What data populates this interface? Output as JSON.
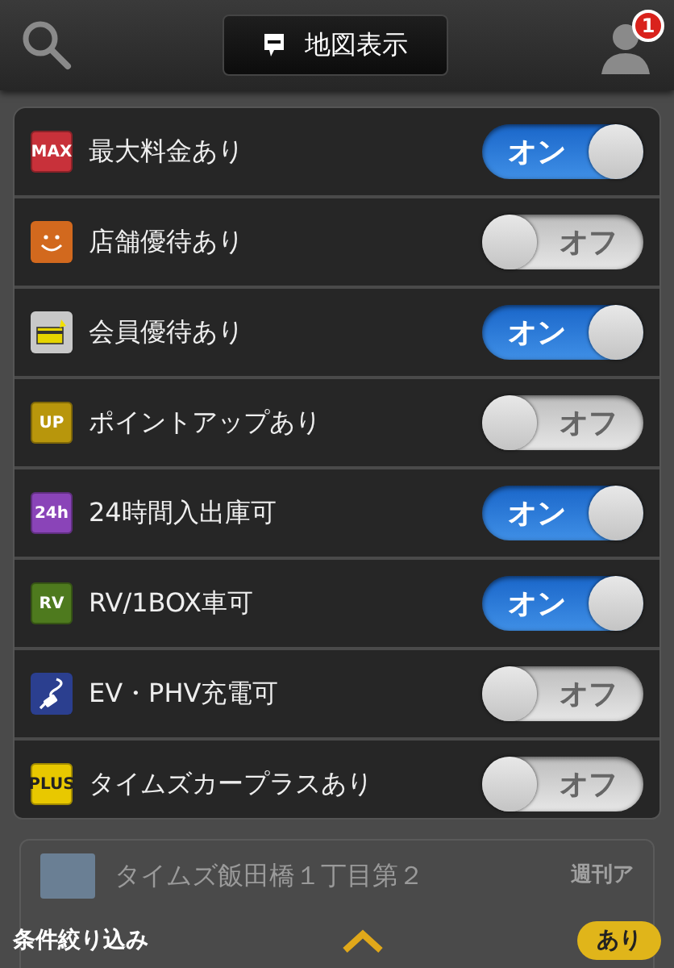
{
  "header": {
    "map_button": "地図表示",
    "notification_count": "1"
  },
  "filters": [
    {
      "label": "最大料金あり",
      "on": true,
      "switch_text": "オン",
      "icon": {
        "kind": "text",
        "text": "MAX",
        "color": "#c8313a"
      }
    },
    {
      "label": "店舗優待あり",
      "on": false,
      "switch_text": "オフ",
      "icon": {
        "kind": "smile",
        "color": "#d2691e"
      }
    },
    {
      "label": "会員優待あり",
      "on": true,
      "switch_text": "オン",
      "icon": {
        "kind": "card",
        "color": "#c8c8c8"
      }
    },
    {
      "label": "ポイントアップあり",
      "on": false,
      "switch_text": "オフ",
      "icon": {
        "kind": "text",
        "text": "UP",
        "color": "#b8960c"
      }
    },
    {
      "label": "24時間入出庫可",
      "on": true,
      "switch_text": "オン",
      "icon": {
        "kind": "text",
        "text": "24h",
        "color": "#8a44b8"
      }
    },
    {
      "label": "RV/1BOX車可",
      "on": true,
      "switch_text": "オン",
      "icon": {
        "kind": "text",
        "text": "RV",
        "color": "#4e7a1e"
      }
    },
    {
      "label": "EV・PHV充電可",
      "on": false,
      "switch_text": "オフ",
      "icon": {
        "kind": "plug",
        "color": "#2b3f8f"
      }
    },
    {
      "label": "タイムズカープラスあり",
      "on": false,
      "switch_text": "オフ",
      "icon": {
        "kind": "text",
        "text": "PLUS",
        "color": "#e8c800"
      }
    }
  ],
  "background_listing": {
    "name": "タイムズ飯田橋１丁目第２",
    "tag": "週刊ア"
  },
  "filter_bar": {
    "label": "条件絞り込み",
    "badge": "あり"
  }
}
